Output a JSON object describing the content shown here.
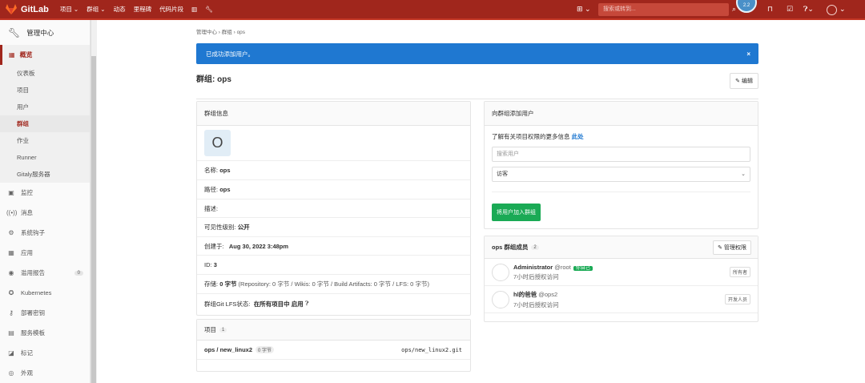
{
  "topbar": {
    "brand": "GitLab",
    "nav": [
      "项目 ⌄",
      "群组 ⌄",
      "动态",
      "里程碑",
      "代码片段"
    ],
    "search_placeholder": "搜索或转到...",
    "bubble": "2.2"
  },
  "sidebar": {
    "header": "管理中心",
    "overview": "概览",
    "sub_items": [
      "仪表板",
      "项目",
      "用户",
      "群组",
      "作业",
      "Runner",
      "Gitaly服务器"
    ],
    "items": [
      {
        "label": "监控",
        "icon": "monitor-icon"
      },
      {
        "label": "消息",
        "icon": "broadcast-icon"
      },
      {
        "label": "系统钩子",
        "icon": "hook-icon"
      },
      {
        "label": "应用",
        "icon": "apps-icon"
      },
      {
        "label": "滥用报告",
        "icon": "abuse-icon",
        "badge": "0"
      },
      {
        "label": "Kubernetes",
        "icon": "kubernetes-icon"
      },
      {
        "label": "部署密钥",
        "icon": "key-icon"
      },
      {
        "label": "服务模板",
        "icon": "template-icon"
      },
      {
        "label": "标记",
        "icon": "label-icon"
      },
      {
        "label": "外观",
        "icon": "appearance-icon"
      }
    ]
  },
  "breadcrumb": [
    "管理中心",
    "群组",
    "ops"
  ],
  "alert": "已成功添加用户。",
  "page": {
    "title": "群组: ops",
    "edit": "编辑"
  },
  "group_info": {
    "header": "群组信息",
    "avatar_letter": "O",
    "name_label": "名称:",
    "name": "ops",
    "path_label": "路径:",
    "path": "ops",
    "desc_label": "描述:",
    "visibility_label": "可见性级别:",
    "visibility": "公开",
    "created_label": "创建于:",
    "created": "Aug 30, 2022 3:48pm",
    "id_label": "ID:",
    "id": "3",
    "storage_label": "存储:",
    "storage_value": "0 字节",
    "storage_detail": "(Repository: 0 字节 / Wikis: 0 字节 / Build Artifacts: 0 字节 / LFS: 0 字节)",
    "lfs_label": "群组Git LFS状态:",
    "lfs_value": "在所有项目中 启用"
  },
  "projects": {
    "header": "项目",
    "count": "1",
    "items": [
      {
        "name": "ops / new_linux2",
        "size": "0 字节",
        "path": "ops/new_linux2.git"
      }
    ]
  },
  "add_user": {
    "header": "向群组添加用户",
    "info": "了解有关项目权限的更多信息",
    "info_link": "此处",
    "search_placeholder": "搜索用户",
    "role": "访客",
    "button": "将用户加入群组"
  },
  "members": {
    "header": "ops 群组成员",
    "count": "2",
    "manage": "管理权限",
    "items": [
      {
        "name": "Administrator",
        "handle": "@root",
        "you": "你自己",
        "time": "7小时后授权访问",
        "role": "所有者"
      },
      {
        "name": "hl的爸爸",
        "handle": "@ops2",
        "you": "",
        "time": "7小时后授权访问",
        "role": "开发人员"
      }
    ]
  }
}
